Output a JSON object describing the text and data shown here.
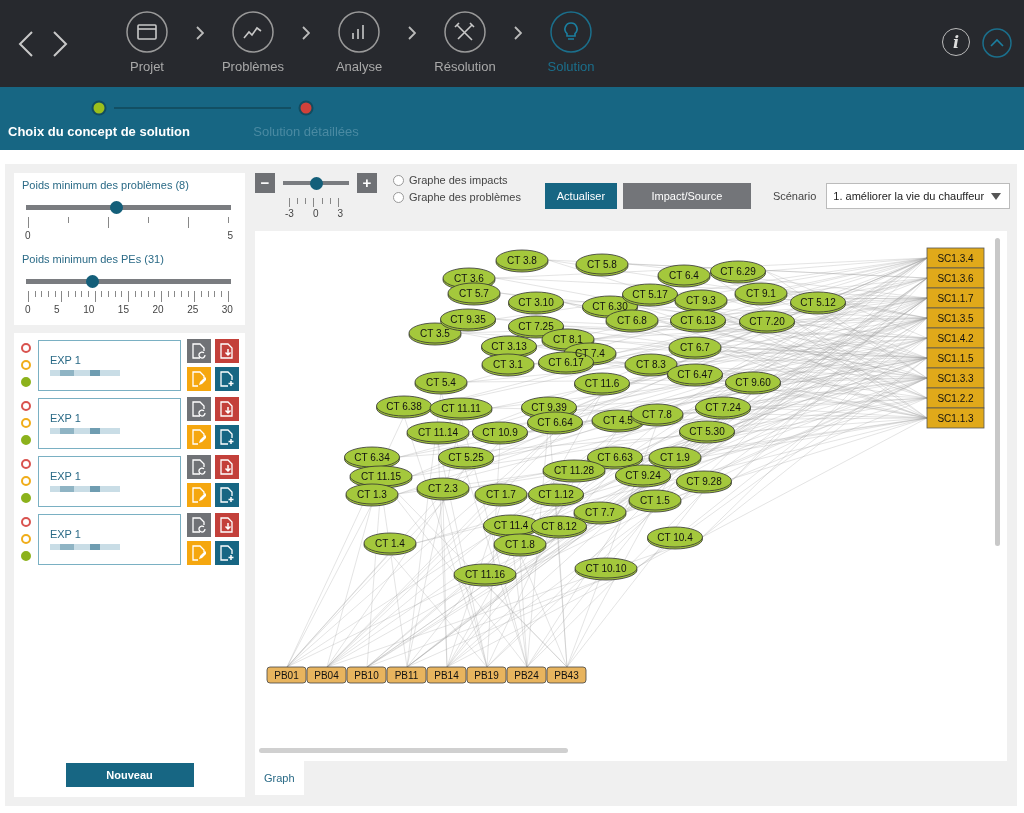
{
  "steps": [
    {
      "label": "Projet",
      "selected": false
    },
    {
      "label": "Problèmes",
      "selected": false
    },
    {
      "label": "Analyse",
      "selected": false
    },
    {
      "label": "Résolution",
      "selected": false
    },
    {
      "label": "Solution",
      "selected": true
    }
  ],
  "info_button": "i",
  "substeps": [
    {
      "label": "Choix du concept de solution",
      "selected": true,
      "color": "#9bbf1c"
    },
    {
      "label": "Solution détaillées",
      "selected": false,
      "color": "#d0413a"
    }
  ],
  "sliders": [
    {
      "label": "Poids minimum des problèmes (8)",
      "level": 0.44,
      "ticks": [
        "0",
        "5"
      ]
    },
    {
      "label": "Poids minimum des PEs (31)",
      "level": 0.32,
      "ticks": [
        "0",
        "5",
        "10",
        "15",
        "20",
        "25",
        "30"
      ]
    }
  ],
  "experiments": [
    {
      "title": "EXP 1",
      "dots": [
        {
          "color": "#d9534f",
          "filled": false
        },
        {
          "color": "#f0ad1a",
          "filled": false
        },
        {
          "color": "#8cb21c",
          "filled": true
        }
      ]
    },
    {
      "title": "EXP 1",
      "dots": [
        {
          "color": "#d9534f",
          "filled": false
        },
        {
          "color": "#f0ad1a",
          "filled": false
        },
        {
          "color": "#8cb21c",
          "filled": true
        }
      ]
    },
    {
      "title": "EXP 1",
      "dots": [
        {
          "color": "#d9534f",
          "filled": false
        },
        {
          "color": "#f0ad1a",
          "filled": false
        },
        {
          "color": "#8cb21c",
          "filled": true
        }
      ]
    },
    {
      "title": "EXP 1",
      "dots": [
        {
          "color": "#d9534f",
          "filled": false
        },
        {
          "color": "#f0ad1a",
          "filled": false
        },
        {
          "color": "#8cb21c",
          "filled": true
        }
      ]
    }
  ],
  "new_button": "Nouveau",
  "zoom": {
    "minus": "−",
    "plus": "+",
    "level": 0.5,
    "ticks": [
      "-3",
      "0",
      "3"
    ]
  },
  "graph_modes": [
    {
      "label": "Graphe des impacts",
      "selected": false
    },
    {
      "label": "Graphe des problèmes",
      "selected": false
    }
  ],
  "refresh_button": "Actualiser",
  "impact_button": "Impact/Source",
  "scenario": {
    "label": "Scénario",
    "value": "1. améliorer la vie du chauffeur"
  },
  "graph": {
    "nodes": [
      "CT 3.6",
      "CT 3.8",
      "CT 5.8",
      "CT 6.4",
      "CT 6.29",
      "CT 5.7",
      "CT 3.10",
      "CT 6.30",
      "CT 5.17",
      "CT 9.3",
      "CT 9.1",
      "CT 5.12",
      "CT 3.5",
      "CT 9.35",
      "CT 7.25",
      "CT 6.8",
      "CT 6.13",
      "CT 7.20",
      "CT 3.13",
      "CT 8.1",
      "CT 7.4",
      "CT 6.7",
      "CT 5.4",
      "CT 3.1",
      "CT 6.17",
      "CT 11.6",
      "CT 8.3",
      "CT 6.47",
      "CT 9.60",
      "CT 6.38",
      "CT 11.11",
      "CT 9.39",
      "CT 6.64",
      "CT 4.5",
      "CT 7.8",
      "CT 7.24",
      "CT 11.14",
      "CT 10.9",
      "CT 5.30",
      "CT 6.34",
      "CT 5.25",
      "CT 6.63",
      "CT 1.9",
      "CT 11.15",
      "CT 2.3",
      "CT 11.28",
      "CT 9.24",
      "CT 9.28",
      "CT 1.3",
      "CT 1.7",
      "CT 1.12",
      "CT 7.7",
      "CT 1.5",
      "CT 1.4",
      "CT 11.4",
      "CT 1.8",
      "CT 8.12",
      "CT 10.4",
      "CT 11.16",
      "CT 10.10"
    ],
    "sources": [
      "SC1.3.4",
      "SC1.3.6",
      "SC1.1.7",
      "SC1.3.5",
      "SC1.4.2",
      "SC1.1.5",
      "SC1.3.3",
      "SC1.2.2",
      "SC1.1.3"
    ],
    "problems": [
      "PB01",
      "PB04",
      "PB10",
      "PB11",
      "PB14",
      "PB19",
      "PB24",
      "PB43"
    ]
  },
  "tabs": [
    {
      "label": "Graph",
      "selected": true
    }
  ]
}
